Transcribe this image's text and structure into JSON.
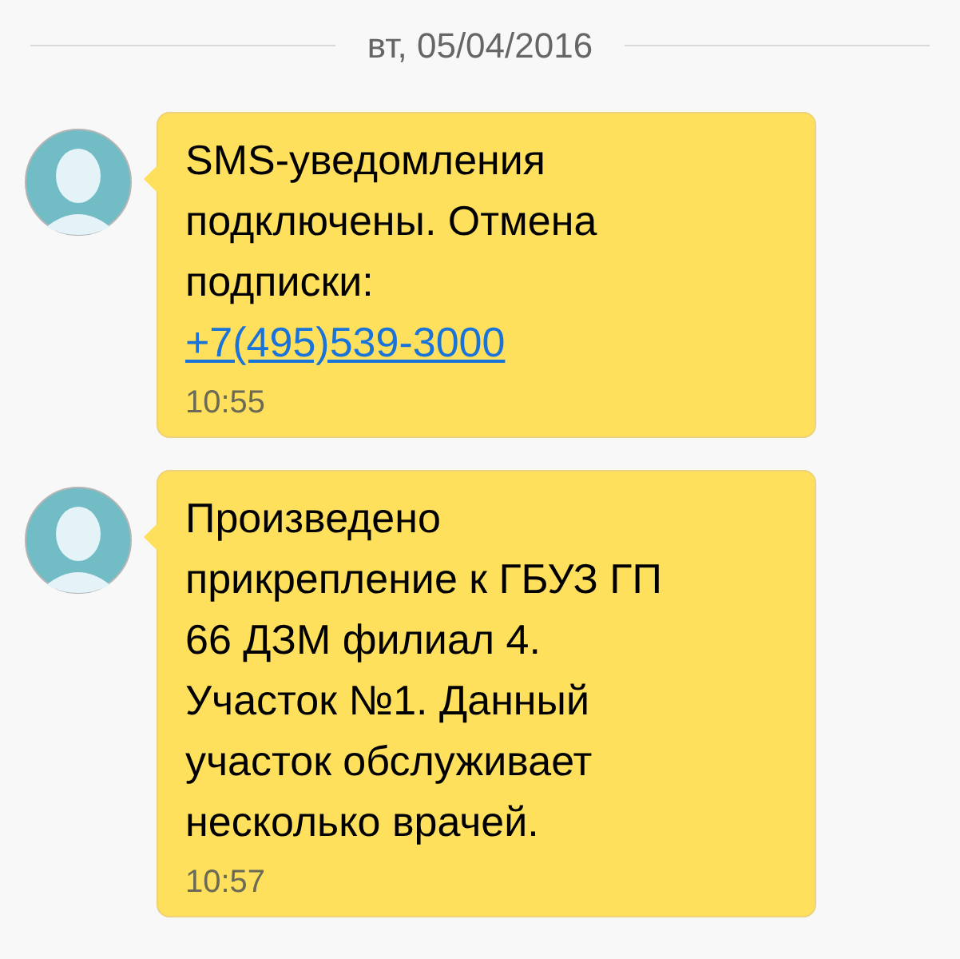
{
  "date_divider": "вт, 05/04/2016",
  "messages": [
    {
      "text": "SMS-уведомления\nподключены. Отмена\nподписки:",
      "link": "+7(495)539-3000",
      "time": "10:55"
    },
    {
      "text": "Произведено\nприкрепление к ГБУЗ ГП\n66 ДЗМ филиал 4.\nУчасток №1. Данный\nучасток обслуживает\nнесколько врачей.",
      "time": "10:57"
    }
  ]
}
